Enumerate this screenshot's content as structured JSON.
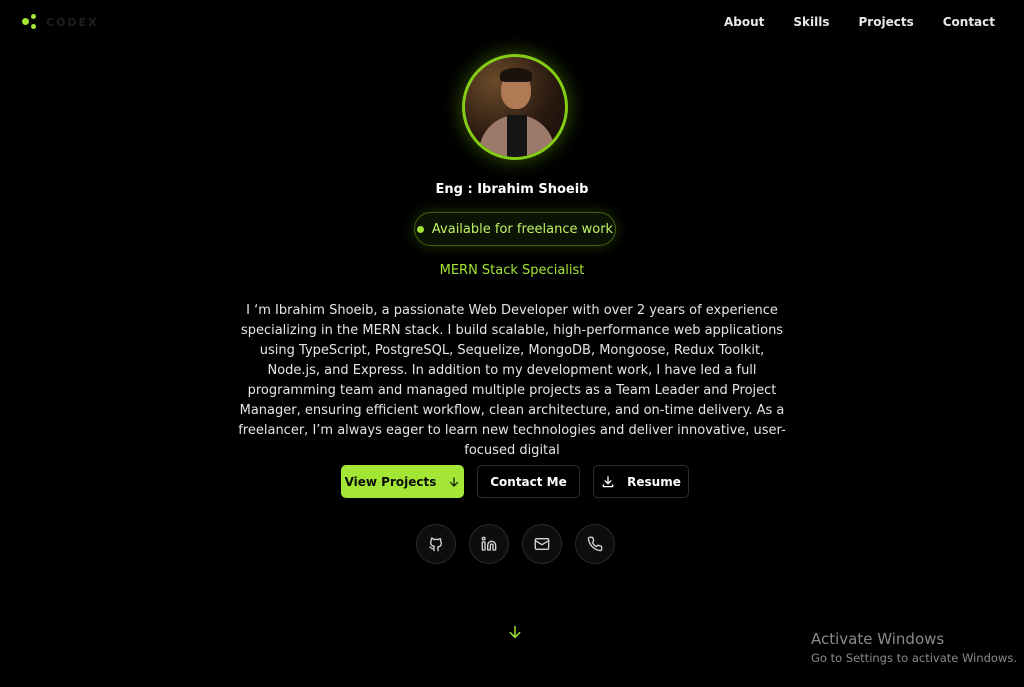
{
  "brand": {
    "logo_text": "CODEX"
  },
  "nav": {
    "items": [
      {
        "label": "About"
      },
      {
        "label": "Skills"
      },
      {
        "label": "Projects"
      },
      {
        "label": "Contact"
      }
    ]
  },
  "hero": {
    "name": "Eng : Ibrahim Shoeib",
    "badge": "Available for freelance work",
    "role": "MERN Stack Specialist",
    "bio": "I ‘m Ibrahim Shoeib, a passionate Web Developer with over 2 years of experience specializing in the MERN stack. I build scalable, high-performance web applications using TypeScript, PostgreSQL, Sequelize, MongoDB, Mongoose, Redux Toolkit, Node.js, and Express. In addition to my development work, I have led a full programming team and managed multiple projects as a Team Leader and Project Manager, ensuring efficient workflow, clean architecture, and on-time delivery. As a freelancer, I’m always eager to learn new technologies and deliver innovative, user-focused digital"
  },
  "actions": {
    "view_projects": "View Projects",
    "contact_me": "Contact Me",
    "resume": "Resume"
  },
  "social": [
    {
      "icon": "github-icon"
    },
    {
      "icon": "linkedin-icon"
    },
    {
      "icon": "mail-icon"
    },
    {
      "icon": "phone-icon"
    }
  ],
  "watermark": {
    "title": "Activate Windows",
    "subtitle": "Go to Settings to activate Windows."
  },
  "colors": {
    "background": "#000000",
    "accent": "#a3e635",
    "accent_border": "#84cc16",
    "text": "#e5e5e5"
  }
}
